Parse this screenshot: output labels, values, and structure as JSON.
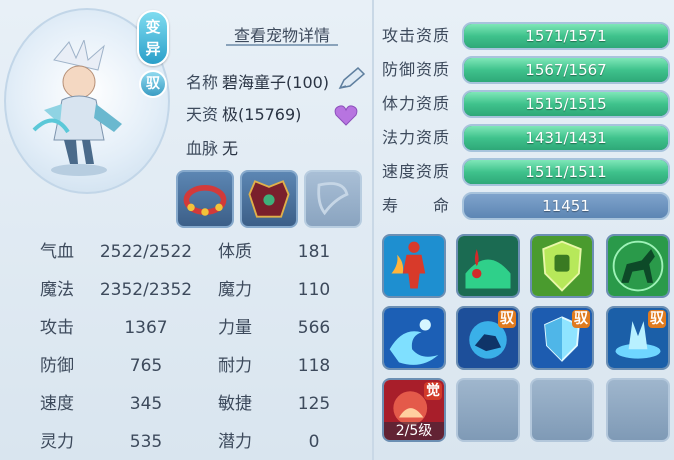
{
  "pet": {
    "transform_badge": "变异",
    "ride_badge": "驭",
    "detail_link": "查看宠物详情",
    "name_label": "名称",
    "name_value": "碧海童子(100)",
    "talent_label": "天资",
    "talent_value": "极(15769)",
    "bloodline_label": "血脉",
    "bloodline_value": "无"
  },
  "stats": [
    {
      "label": "气血",
      "value": "2522/2522"
    },
    {
      "label": "体质",
      "value": "181"
    },
    {
      "label": "魔法",
      "value": "2352/2352"
    },
    {
      "label": "魔力",
      "value": "110"
    },
    {
      "label": "攻击",
      "value": "1367"
    },
    {
      "label": "力量",
      "value": "566"
    },
    {
      "label": "防御",
      "value": "765"
    },
    {
      "label": "耐力",
      "value": "118"
    },
    {
      "label": "速度",
      "value": "345"
    },
    {
      "label": "敏捷",
      "value": "125"
    },
    {
      "label": "灵力",
      "value": "535"
    },
    {
      "label": "潜力",
      "value": "0"
    }
  ],
  "aptitudes": [
    {
      "label": "攻击资质",
      "value": "1571/1571",
      "fill": 1.0
    },
    {
      "label": "防御资质",
      "value": "1567/1567",
      "fill": 1.0
    },
    {
      "label": "体力资质",
      "value": "1515/1515",
      "fill": 1.0
    },
    {
      "label": "法力资质",
      "value": "1431/1431",
      "fill": 1.0
    },
    {
      "label": "速度资质",
      "value": "1511/1511",
      "fill": 1.0
    }
  ],
  "lifespan": {
    "label": "寿　　命",
    "value": "11451"
  },
  "skills": {
    "ride_tag": "驭",
    "awaken_tag": "觉",
    "awaken_level": "2/5级",
    "icons": [
      "fire-warrior-icon",
      "blood-drain-icon",
      "shield-emblem-icon",
      "horse-rider-icon",
      "water-wave-icon",
      "water-beast-icon",
      "water-shield-icon",
      "water-vortex-icon",
      "awaken-skill-icon"
    ]
  },
  "colors": {
    "aptitude_fill": "#3fc28c",
    "bar_track": "#3a5878",
    "badge": "#2a9fc9",
    "ride_tag": "#e07b1f"
  }
}
